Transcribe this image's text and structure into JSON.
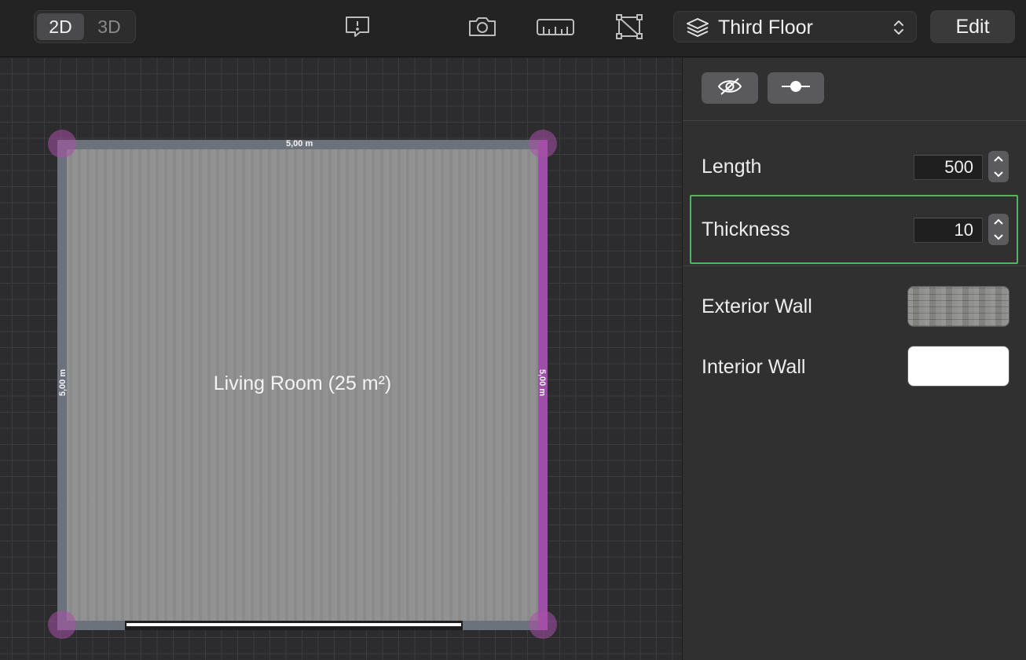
{
  "toolbar": {
    "view_2d": "2D",
    "view_3d": "3D",
    "floor_selector": "Third Floor",
    "edit_label": "Edit",
    "icons": [
      "feedback-icon",
      "camera-icon",
      "ruler-icon",
      "wall-edit-icon",
      "layers-icon",
      "updown-chevron-icon"
    ]
  },
  "canvas": {
    "room_label": "Living Room (25 m²)",
    "dimensions": {
      "top": "5,00 m",
      "left": "5,00 m",
      "right": "5,00 m"
    },
    "selected_wall_color": "#9b4fa6",
    "wall_color": "#6b727b"
  },
  "inspector": {
    "buttons": [
      "hide-icon",
      "wall-handle-icon"
    ],
    "length": {
      "label": "Length",
      "value": "500"
    },
    "thickness": {
      "label": "Thickness",
      "value": "10",
      "highlighted": true,
      "highlight_color": "#4eb85a"
    },
    "exterior_wall": {
      "label": "Exterior Wall",
      "material": "stone texture"
    },
    "interior_wall": {
      "label": "Interior Wall",
      "color": "#ffffff"
    }
  }
}
